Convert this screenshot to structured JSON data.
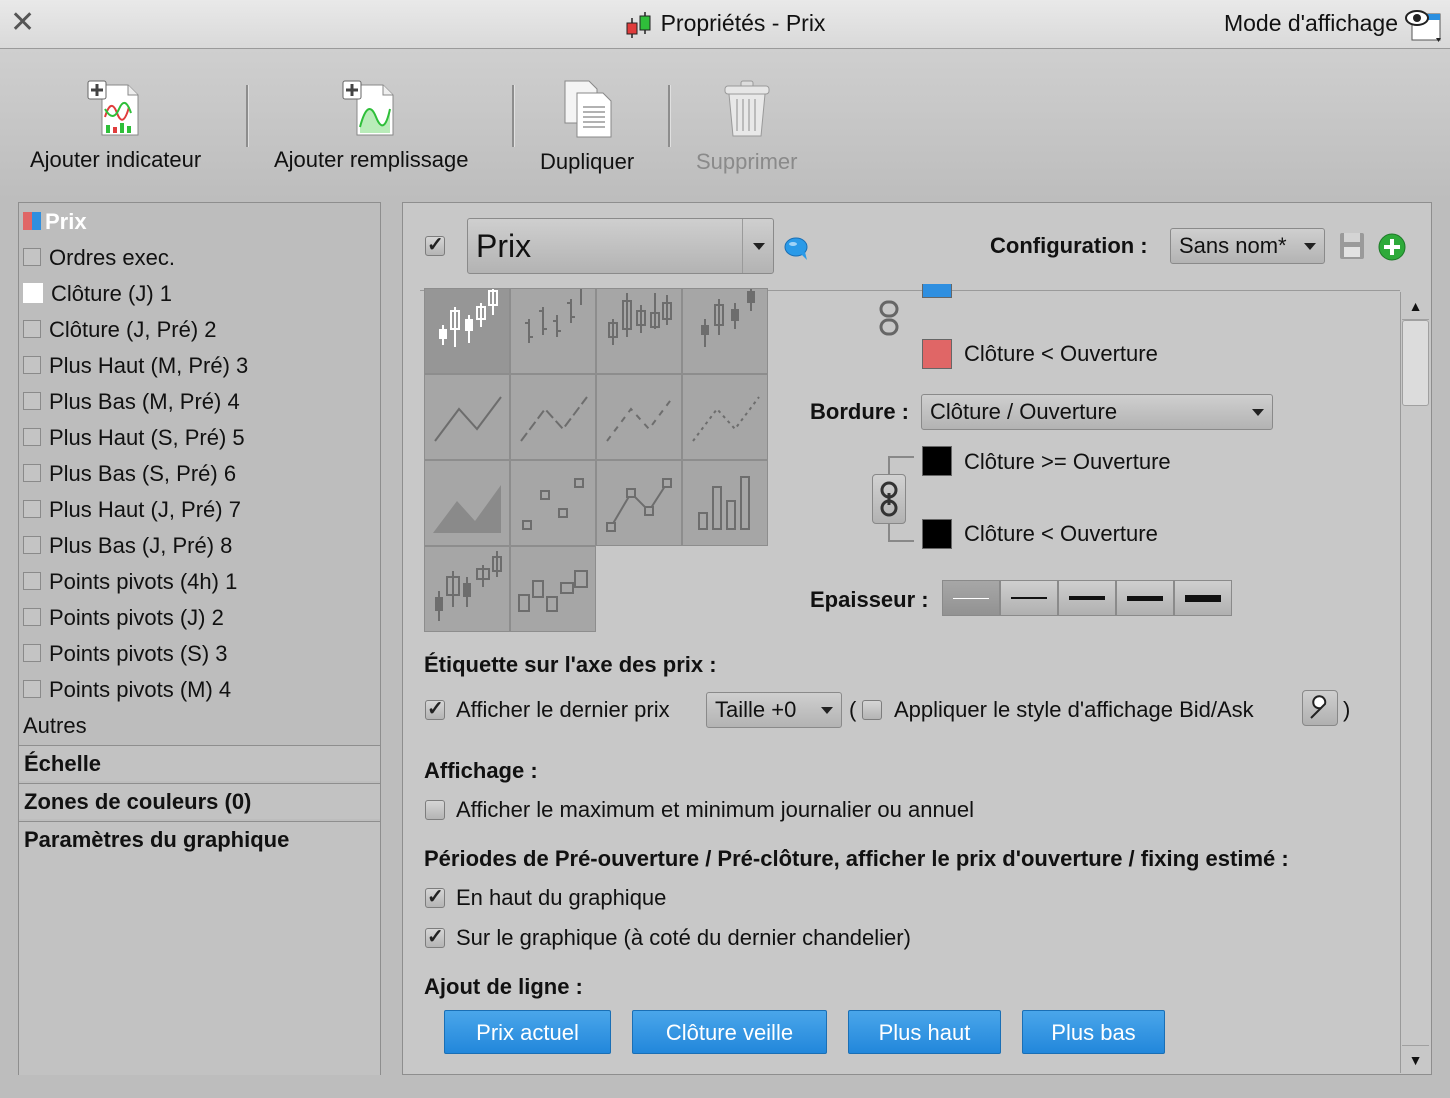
{
  "window": {
    "title": "Propriétés - Prix",
    "view_mode": "Mode d'affichage"
  },
  "toolbar": {
    "add_indicator": "Ajouter indicateur",
    "add_fill": "Ajouter remplissage",
    "duplicate": "Dupliquer",
    "delete": "Supprimer"
  },
  "sidebar": {
    "items": [
      {
        "label": "Prix"
      },
      {
        "label": "Ordres exec."
      },
      {
        "label": "Clôture (J) 1"
      },
      {
        "label": "Clôture (J, Pré) 2"
      },
      {
        "label": "Plus Haut (M, Pré) 3"
      },
      {
        "label": "Plus Bas (M, Pré) 4"
      },
      {
        "label": "Plus Haut (S, Pré) 5"
      },
      {
        "label": "Plus Bas (S, Pré) 6"
      },
      {
        "label": "Plus Haut (J, Pré) 7"
      },
      {
        "label": "Plus Bas (J, Pré) 8"
      },
      {
        "label": "Points pivots (4h) 1"
      },
      {
        "label": "Points pivots (J) 2"
      },
      {
        "label": "Points pivots (S) 3"
      },
      {
        "label": "Points pivots (M) 4"
      }
    ],
    "others": "Autres",
    "sections": [
      "Échelle",
      "Zones de couleurs (0)",
      "Paramètres du graphique"
    ]
  },
  "header": {
    "name_value": "Prix",
    "config_label": "Configuration :",
    "config_value": "Sans nom*"
  },
  "colors": {
    "up_fill": "#2f8fe0",
    "down_fill": "#e06666",
    "border_up": "#000000",
    "border_down": "#000000",
    "accent": "#2a8fe0",
    "add_green": "#2eaa3a"
  },
  "fill_colors": {
    "down_label": "Clôture < Ouverture"
  },
  "border": {
    "label": "Bordure :",
    "value": "Clôture / Ouverture",
    "up_label": "Clôture >= Ouverture",
    "down_label": "Clôture < Ouverture"
  },
  "thickness": {
    "label": "Epaisseur :",
    "selected_index": 0
  },
  "price_axis": {
    "heading": "Étiquette sur l'axe des prix :",
    "show_last": "Afficher le dernier prix",
    "size_value": "Taille +0",
    "open_paren": "(",
    "bidask": "Appliquer le style d'affichage Bid/Ask",
    "close_paren": ")"
  },
  "display": {
    "heading": "Affichage :",
    "show_minmax": "Afficher le maximum et minimum journalier ou annuel"
  },
  "preopen": {
    "heading": "Périodes de Pré-ouverture / Pré-clôture, afficher le prix d'ouverture / fixing estimé :",
    "top": "En haut du graphique",
    "on_chart": "Sur le graphique (à coté du dernier chandelier)"
  },
  "add_line": {
    "heading": "Ajout de ligne :",
    "buttons": [
      "Prix actuel",
      "Clôture veille",
      "Plus haut",
      "Plus bas"
    ]
  }
}
